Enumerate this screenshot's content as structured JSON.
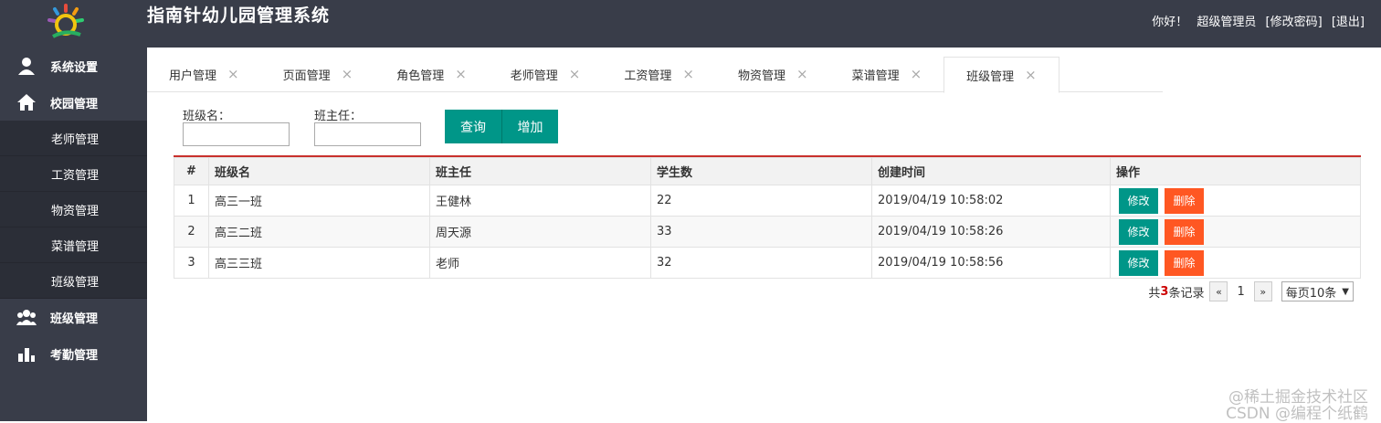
{
  "header": {
    "title": "指南针幼儿园管理系统",
    "greeting": "你好！",
    "user": "超级管理员",
    "change_password": "[修改密码]",
    "logout": "[退出]"
  },
  "sidebar": {
    "items": [
      {
        "label": "系统设置",
        "icon": "user-icon"
      },
      {
        "label": "校园管理",
        "icon": "home-icon"
      },
      {
        "label": "班级管理",
        "icon": "group-icon"
      },
      {
        "label": "考勤管理",
        "icon": "bar-chart-icon"
      }
    ],
    "sub_items": [
      "老师管理",
      "工资管理",
      "物资管理",
      "菜谱管理",
      "班级管理"
    ]
  },
  "tabs": [
    "用户管理",
    "页面管理",
    "角色管理",
    "老师管理",
    "工资管理",
    "物资管理",
    "菜谱管理",
    "班级管理"
  ],
  "active_tab": "班级管理",
  "search": {
    "class_label": "班级名：",
    "teacher_label": "班主任：",
    "class_value": "",
    "teacher_value": "",
    "query_button": "查询",
    "add_button": "增加"
  },
  "table": {
    "headers": [
      "#",
      "班级名",
      "班主任",
      "学生数",
      "创建时间",
      "操作"
    ],
    "rows": [
      [
        "1",
        "高三一班",
        "王健林",
        "22",
        "2019/04/19 10:58:02"
      ],
      [
        "2",
        "高三二班",
        "周天源",
        "33",
        "2019/04/19 10:58:26"
      ],
      [
        "3",
        "高三三班",
        "老师",
        "32",
        "2019/04/19 10:58:56"
      ]
    ],
    "edit_label": "修改",
    "delete_label": "删除"
  },
  "pager": {
    "total_prefix": "共",
    "total": "3",
    "total_suffix": "条记录",
    "prev": "«",
    "page": "1",
    "next": "»",
    "page_size": "每页10条"
  },
  "watermark": [
    "@稀土掘金技术社区",
    "CSDN @编程个纸鹤"
  ],
  "colors": {
    "header_bg": "#393d49",
    "primary": "#009688",
    "danger": "#ff5722",
    "table_accent": "#c9302c"
  }
}
